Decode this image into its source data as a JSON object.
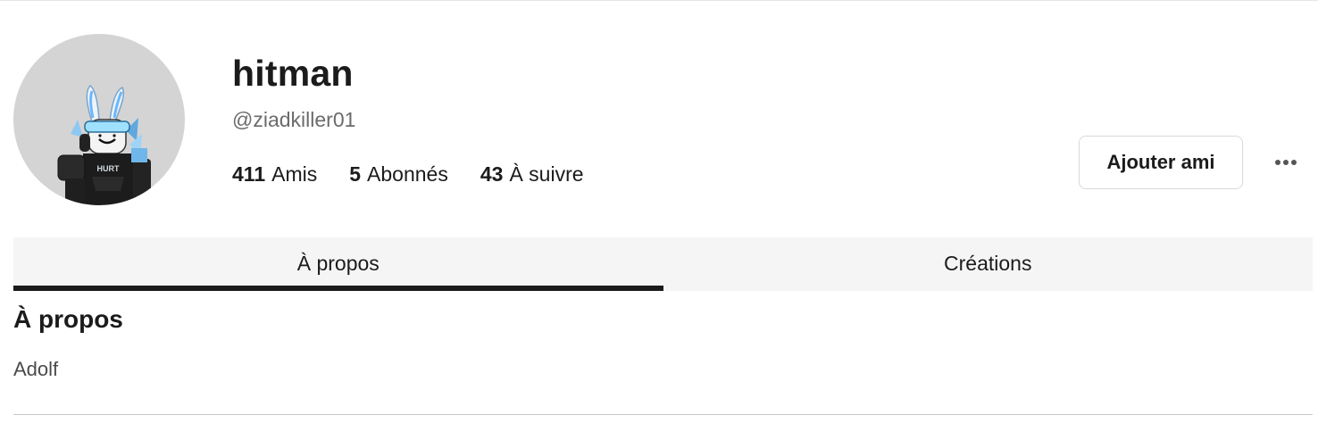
{
  "profile": {
    "display_name": "hitman",
    "username": "@ziadkiller01",
    "avatar_alt": "Avatar"
  },
  "stats": [
    {
      "count": "411",
      "label": "Amis"
    },
    {
      "count": "5",
      "label": "Abonnés"
    },
    {
      "count": "43",
      "label": "À suivre"
    }
  ],
  "actions": {
    "add_friend_label": "Ajouter ami",
    "more_icon": "more-horizontal-icon"
  },
  "tabs": [
    {
      "label": "À propos",
      "active": true
    },
    {
      "label": "Créations",
      "active": false
    }
  ],
  "about": {
    "title": "À propos",
    "text": "Adolf"
  },
  "colors": {
    "text": "#1b1b1b",
    "muted": "#6b6b6b",
    "tab_bg": "#f5f5f5",
    "avatar_bg": "#d4d4d4"
  }
}
